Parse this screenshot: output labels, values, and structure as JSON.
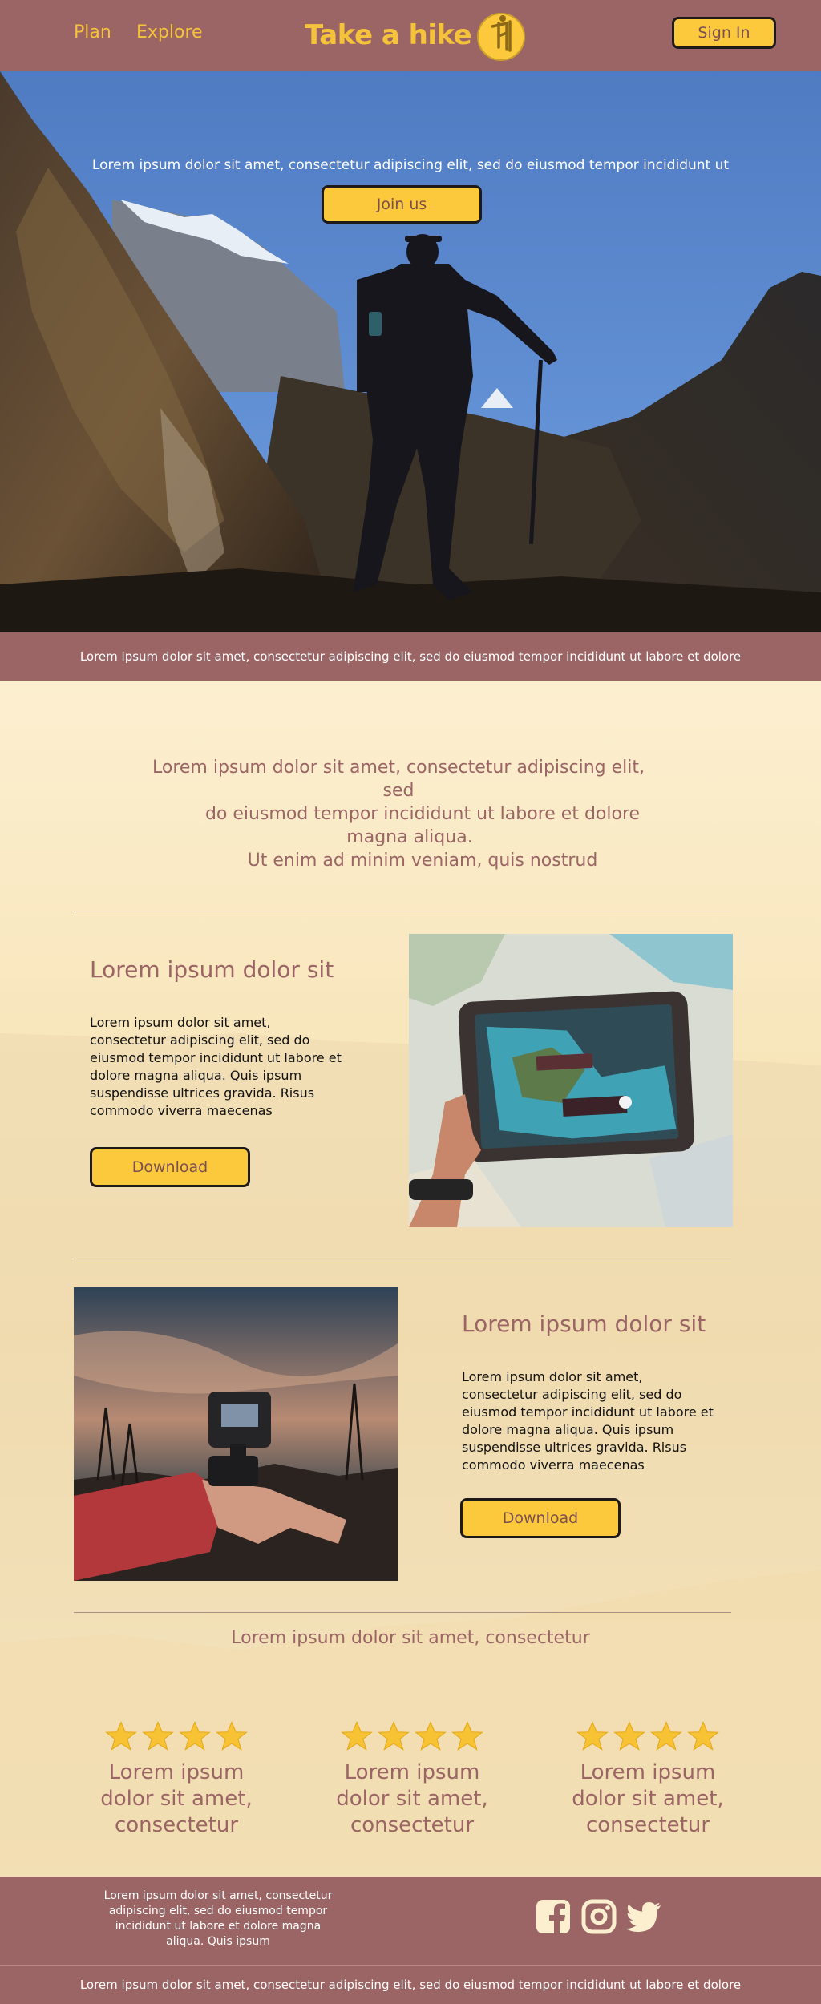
{
  "nav": {
    "plan": "Plan",
    "explore": "Explore",
    "brand": "Take a hike",
    "sign_in": "Sign In"
  },
  "hero": {
    "tagline": "Lorem ipsum dolor sit amet, consectetur adipiscing elit, sed do eiusmod tempor incididunt ut",
    "cta": "Join us"
  },
  "banner": {
    "text": "Lorem ipsum dolor sit amet, consectetur adipiscing elit, sed do eiusmod tempor incididunt ut labore et dolore"
  },
  "intro": {
    "lines": [
      "Lorem ipsum dolor sit amet, consectetur adipiscing elit,",
      "sed",
      "do eiusmod tempor incididunt ut labore et dolore",
      "magna aliqua.",
      "Ut enim ad minim veniam, quis nostrud"
    ]
  },
  "features": [
    {
      "title": "Lorem ipsum dolor sit",
      "body": "Lorem ipsum dolor sit amet, consectetur adipiscing elit, sed do eiusmod tempor incididunt ut labore et dolore magna aliqua. Quis ipsum suspendisse ultrices gravida. Risus commodo viverra maecenas",
      "button": "Download",
      "image": "tablet-map-photo"
    },
    {
      "title": "Lorem ipsum dolor sit",
      "body": "Lorem ipsum dolor sit amet, consectetur adipiscing elit, sed do eiusmod tempor incididunt ut labore et dolore magna aliqua. Quis ipsum suspendisse ultrices gravida. Risus commodo viverra maecenas",
      "button": "Download",
      "image": "action-camera-wrist-photo"
    }
  ],
  "reviews": {
    "heading": "Lorem ipsum dolor sit amet, consectetur",
    "items": [
      {
        "stars": 4,
        "text": "Lorem ipsum dolor sit amet, consectetur"
      },
      {
        "stars": 4,
        "text": "Lorem ipsum dolor sit amet, consectetur"
      },
      {
        "stars": 4,
        "text": "Lorem ipsum dolor sit amet, consectetur"
      }
    ]
  },
  "footer": {
    "text": "Lorem ipsum dolor sit amet, consectetur adipiscing elit, sed do eiusmod tempor incididunt ut labore et dolore magna aliqua. Quis ipsum",
    "social_icons": [
      "facebook-icon",
      "instagram-icon",
      "twitter-icon"
    ],
    "bottom": "Lorem ipsum dolor sit amet, consectetur adipiscing elit, sed do eiusmod tempor incididunt ut labore et dolore"
  },
  "colors": {
    "header_bg": "#9b6565",
    "accent_yellow": "#fcc93c",
    "page_bg": "#fbecc6",
    "heading_text": "#9b6565"
  }
}
